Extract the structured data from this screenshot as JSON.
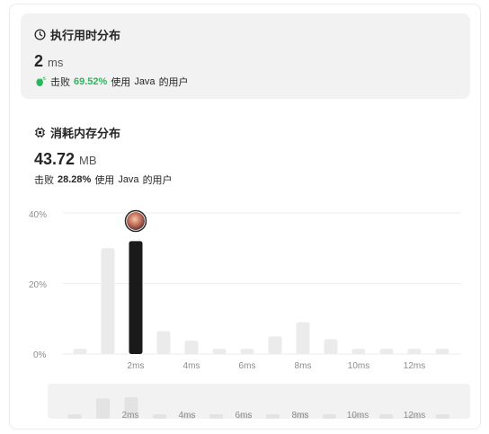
{
  "runtime": {
    "title": "执行用时分布",
    "value": "2",
    "unit": "ms",
    "beat_prefix": "击败",
    "beat_percent": "69.52%",
    "beat_middle": "使用",
    "language": "Java",
    "beat_suffix": "的用户",
    "accent_color": "#2db55d"
  },
  "memory": {
    "title": "消耗内存分布",
    "value": "43.72",
    "unit": "MB",
    "beat_prefix": "击败",
    "beat_percent": "28.28%",
    "beat_middle": "使用",
    "language": "Java",
    "beat_suffix": "的用户"
  },
  "chart_data": {
    "type": "bar",
    "y_ticks": [
      "0%",
      "20%",
      "40%"
    ],
    "ylim": [
      0,
      40
    ],
    "x_ticks": [
      "2ms",
      "4ms",
      "6ms",
      "8ms",
      "10ms",
      "12ms"
    ],
    "values": [
      1.5,
      30,
      32,
      6.5,
      3.8,
      1.5,
      1.5,
      5,
      9,
      4.2,
      1.5,
      1.5,
      1.5,
      1.5
    ],
    "highlight_index": 2,
    "bar_color": "#ebebeb",
    "highlight_color": "#1a1a1a"
  },
  "overview": {
    "x_ticks": [
      "2ms",
      "4ms",
      "6ms",
      "8ms",
      "10ms",
      "12ms"
    ]
  }
}
